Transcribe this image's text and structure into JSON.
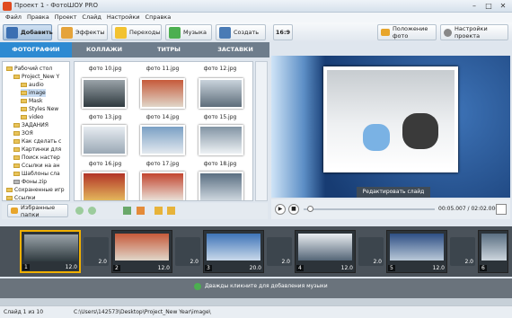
{
  "window": {
    "title": "Проект 1 - ФотоШОУ PRO"
  },
  "menu": [
    "Файл",
    "Правка",
    "Проект",
    "Слайд",
    "Настройки",
    "Справка"
  ],
  "toolbar": {
    "add": "Добавить",
    "effects": "Эффекты",
    "transitions": "Переходы",
    "music": "Музыка",
    "create": "Создать",
    "ratio": "16:9",
    "photo_position": "Положение фото",
    "project_settings": "Настройки проекта"
  },
  "subtabs": [
    "ФОТОГРАФИИ",
    "КОЛЛАЖИ",
    "ТИТРЫ",
    "ЗАСТАВКИ"
  ],
  "tree": [
    "Рабочий стол",
    "Project_New Y",
    "audio",
    "image",
    "Mask",
    "Styles New",
    "video",
    "ЗАДАНИЯ",
    "ЗОЯ",
    "Как сделать с",
    "Картинки для",
    "Поиск настер",
    "Ссылки на ан",
    "Шаблоны сла",
    "Фоны.zip",
    "Сохраненные игр",
    "Ссылки"
  ],
  "photos": [
    "фото 10.jpg",
    "фото 11.jpg",
    "фото 12.jpg",
    "фото 13.jpg",
    "фото 14.jpg",
    "фото 15.jpg",
    "фото 16.jpg",
    "фото 17.jpg",
    "фото 18.jpg"
  ],
  "favorites": "Избранные папки",
  "preview": {
    "edit": "Редактировать слайд",
    "time": "00:05.007 / 02:02.000"
  },
  "timeline": {
    "slides": [
      {
        "n": "1",
        "d": "12.0"
      },
      {
        "n": "2",
        "d": "12.0"
      },
      {
        "n": "3",
        "d": "20.0"
      },
      {
        "n": "4",
        "d": "12.0"
      },
      {
        "n": "5",
        "d": "12.0"
      },
      {
        "n": "6",
        "d": ""
      }
    ],
    "transitions": [
      "2.0",
      "2.0",
      "2.0",
      "2.0",
      "2.0",
      "2.0"
    ]
  },
  "music_hint": "Дважды кликните для добавления музыки",
  "status": {
    "slide": "Слайд 1 из 10",
    "path": "C:\\Users\\142573\\Desktop\\Project_New Year\\image\\"
  }
}
